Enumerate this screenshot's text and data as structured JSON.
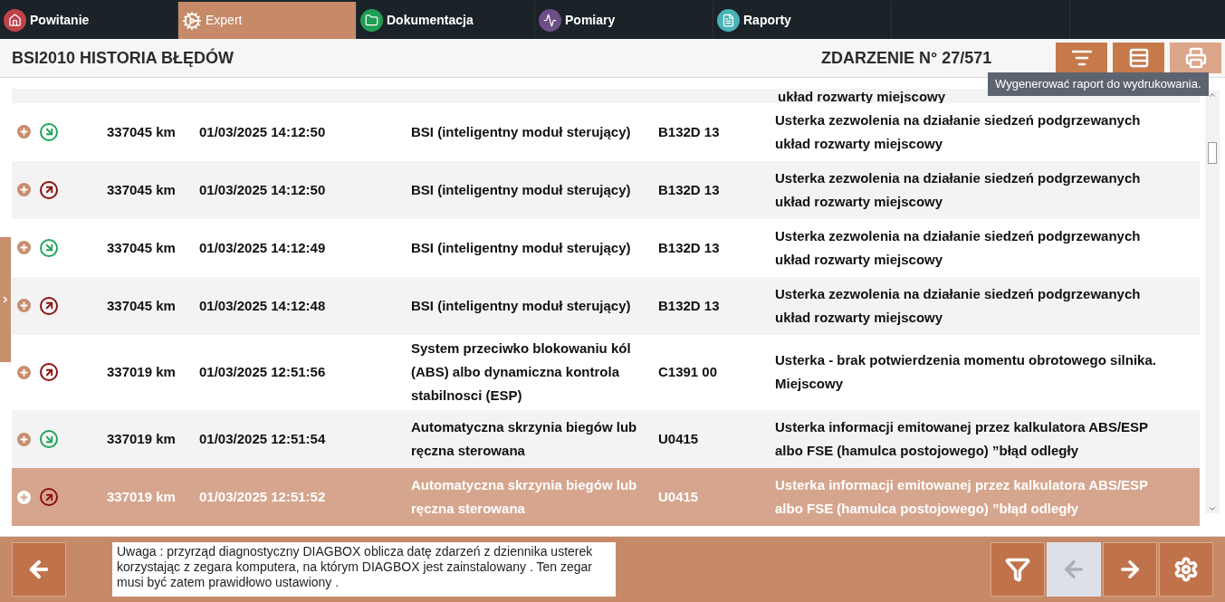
{
  "tabs": [
    {
      "label": "Powitanie",
      "kind": "welcome",
      "selected": false
    },
    {
      "label": "Expert",
      "kind": "expert",
      "selected": true
    },
    {
      "label": "Dokumentacja",
      "kind": "docs",
      "selected": false
    },
    {
      "label": "Pomiary",
      "kind": "measure",
      "selected": false
    },
    {
      "label": "Raporty",
      "kind": "reports",
      "selected": false
    }
  ],
  "header": {
    "title": "BSI2010 HISTORIA BŁĘDÓW",
    "event_counter": "ZDARZENIE N° 27/571"
  },
  "toolbar": [
    {
      "kind": "sort",
      "selected": false
    },
    {
      "kind": "list",
      "selected": false
    },
    {
      "kind": "print",
      "selected": true
    }
  ],
  "tooltip": "Wygenerować raport do wydrukowania.",
  "partial_row": {
    "description": "układ rozwarty miejscowy"
  },
  "rows": [
    {
      "kind": "in",
      "selected": false,
      "mileage": "337045 km",
      "date": "01/03/2025 14:12:50",
      "module": "BSI (inteligentny moduł sterujący)",
      "code": "B132D 13",
      "description": "Usterka zezwolenia na działanie siedzeń podgrzewanych układ rozwarty miejscowy"
    },
    {
      "kind": "out",
      "selected": false,
      "mileage": "337045 km",
      "date": "01/03/2025 14:12:50",
      "module": "BSI (inteligentny moduł sterujący)",
      "code": "B132D 13",
      "description": "Usterka zezwolenia na działanie siedzeń podgrzewanych układ rozwarty miejscowy"
    },
    {
      "kind": "in",
      "selected": false,
      "mileage": "337045 km",
      "date": "01/03/2025 14:12:49",
      "module": "BSI (inteligentny moduł sterujący)",
      "code": "B132D 13",
      "description": "Usterka zezwolenia na działanie siedzeń podgrzewanych układ rozwarty miejscowy"
    },
    {
      "kind": "out",
      "selected": false,
      "mileage": "337045 km",
      "date": "01/03/2025 14:12:48",
      "module": "BSI (inteligentny moduł sterujący)",
      "code": "B132D 13",
      "description": "Usterka zezwolenia na działanie siedzeń podgrzewanych układ rozwarty miejscowy"
    },
    {
      "kind": "out",
      "selected": false,
      "mileage": "337019 km",
      "date": "01/03/2025 12:51:56",
      "module": "System przeciwko blokowaniu kól (ABS) albo dynamiczna kontrola stabilnosci (ESP)",
      "code": "C1391 00",
      "description": "Usterka - brak potwierdzenia momentu obrotowego silnika. Miejscowy"
    },
    {
      "kind": "in",
      "selected": false,
      "mileage": "337019 km",
      "date": "01/03/2025 12:51:54",
      "module": "Automatyczna skrzynia biegów lub ręczna sterowana",
      "code": "U0415",
      "description": "Usterka informacji emitowanej przez kalkulatora ABS/ESP albo FSE (hamulca postojowego) ”błąd odległy"
    },
    {
      "kind": "out",
      "selected": true,
      "mileage": "337019 km",
      "date": "01/03/2025 12:51:52",
      "module": "Automatyczna skrzynia biegów lub ręczna sterowana",
      "code": "U0415",
      "description": "Usterka informacji emitowanej przez kalkulatora ABS/ESP albo FSE (hamulca postojowego) ”błąd odległy"
    }
  ],
  "footer": {
    "note": "Uwaga : przyrząd diagnostyczny DIAGBOX oblicza datę zdarzeń z dziennika usterek korzystając z zegara komputera, na którym DIAGBOX jest zainstalowany . Ten zegar musi być zatem prawidłowo ustawiony .",
    "buttons": [
      {
        "kind": "filter",
        "disabled": false
      },
      {
        "kind": "back",
        "disabled": true
      },
      {
        "kind": "forward",
        "disabled": false
      },
      {
        "kind": "settings",
        "disabled": false
      }
    ]
  }
}
